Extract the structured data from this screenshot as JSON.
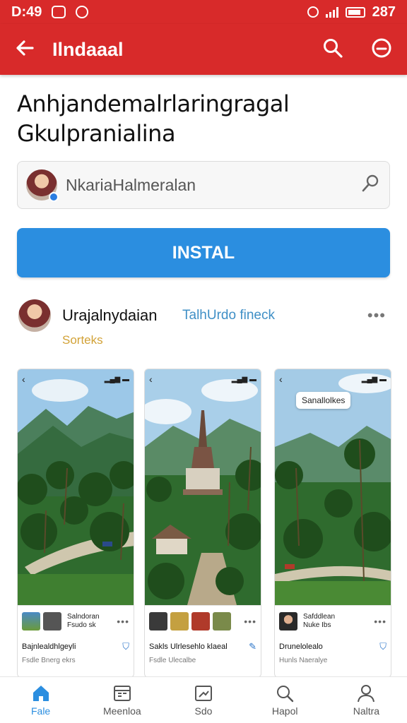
{
  "status_bar": {
    "time": "D:49",
    "right_text": "287"
  },
  "app_bar": {
    "title": "Ilndaaal"
  },
  "headline": {
    "line1": "Anhjandemalrlaringragal",
    "line2": "Gkulpranialina"
  },
  "search": {
    "value": "NkariaHalmeralan"
  },
  "install_button": {
    "label": "INSTAL"
  },
  "author": {
    "name": "Urajalnydaian",
    "tag": "TalhUrdo fineck",
    "subtitle": "Sorteks"
  },
  "screenshots": [
    {
      "scene": "mountains-palms",
      "meta1": "Salndoran",
      "meta2": "Fsudo sk",
      "line": "Bajnlealdhlgeyli",
      "line2": "Fsdle Bnerg ekrs",
      "mark": "bookmark-icon"
    },
    {
      "scene": "pagoda-village",
      "meta1": "",
      "meta2": "",
      "line": "Sakls Ulrlesehlo klaeal",
      "line2": "Fsdle Ulecalbe",
      "mark": "edit-icon"
    },
    {
      "scene": "palm-valley",
      "chip": "Sanallolkes",
      "meta1": "Safddlean",
      "meta2": "Nuke Ibs",
      "line": "Drunelolealo",
      "line2": "Hunls Naeralye",
      "mark": "bookmark-icon"
    }
  ],
  "bottom_nav": [
    {
      "label": "Fale",
      "icon": "home-icon",
      "active": true
    },
    {
      "label": "Meenloa",
      "icon": "calendar-icon",
      "active": false
    },
    {
      "label": "Sdo",
      "icon": "chart-icon",
      "active": false
    },
    {
      "label": "Hapol",
      "icon": "search-icon",
      "active": false
    },
    {
      "label": "Naltra",
      "icon": "profile-icon",
      "active": false
    }
  ],
  "colors": {
    "header": "#d82a2a",
    "accent": "#2b8ee0",
    "tag": "#3f8fc6",
    "subtitle": "#d2a237"
  }
}
